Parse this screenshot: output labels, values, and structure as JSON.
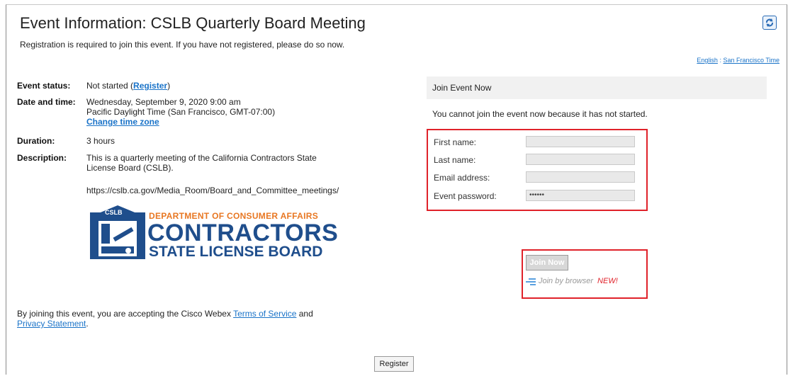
{
  "header": {
    "title": "Event Information: CSLB Quarterly Board Meeting",
    "subtitle": "Registration is required to join this event. If you have not registered, please do so now.",
    "language_link": "English",
    "separator": ":",
    "timezone_link": "San Francisco Time"
  },
  "details": {
    "status_label": "Event status:",
    "status_value": "Not started (",
    "status_link": "Register",
    "status_close": ")",
    "date_label": "Date and time:",
    "date_line1": "Wednesday, September 9, 2020 9:00 am",
    "date_line2": "Pacific Daylight Time (San Francisco, GMT-07:00)",
    "change_tz": "Change time zone",
    "duration_label": "Duration:",
    "duration_value": "3 hours",
    "description_label": "Description:",
    "description_line1": "This is a quarterly meeting of the California Contractors State",
    "description_line2": "License Board (CSLB).",
    "description_url": "https://cslb.ca.gov/Media_Room/Board_and_Committee_meetings/"
  },
  "logo": {
    "badge_text": "CSLB",
    "department": "DEPARTMENT OF CONSUMER AFFAIRS",
    "contractors": "CONTRACTORS",
    "board": "STATE LICENSE BOARD"
  },
  "join": {
    "header": "Join Event Now",
    "not_started_msg": "You cannot join the event now because it has not started.",
    "first_name_label": "First name:",
    "last_name_label": "Last name:",
    "email_label": "Email address:",
    "password_label": "Event password:",
    "password_value": "••••••",
    "join_now_label": "Join Now",
    "join_browser_label": "Join by browser",
    "new_tag": "NEW!"
  },
  "footer": {
    "text_before": "By joining this event, you are accepting the Cisco Webex ",
    "terms_link": "Terms of Service",
    "text_and": " and",
    "privacy_link": "Privacy Statement",
    "text_end": ".",
    "register_button": "Register"
  },
  "colors": {
    "link": "#1a73c8",
    "highlight_border": "#e0222a",
    "logo_blue": "#1f4e8c",
    "logo_orange": "#e87722"
  }
}
